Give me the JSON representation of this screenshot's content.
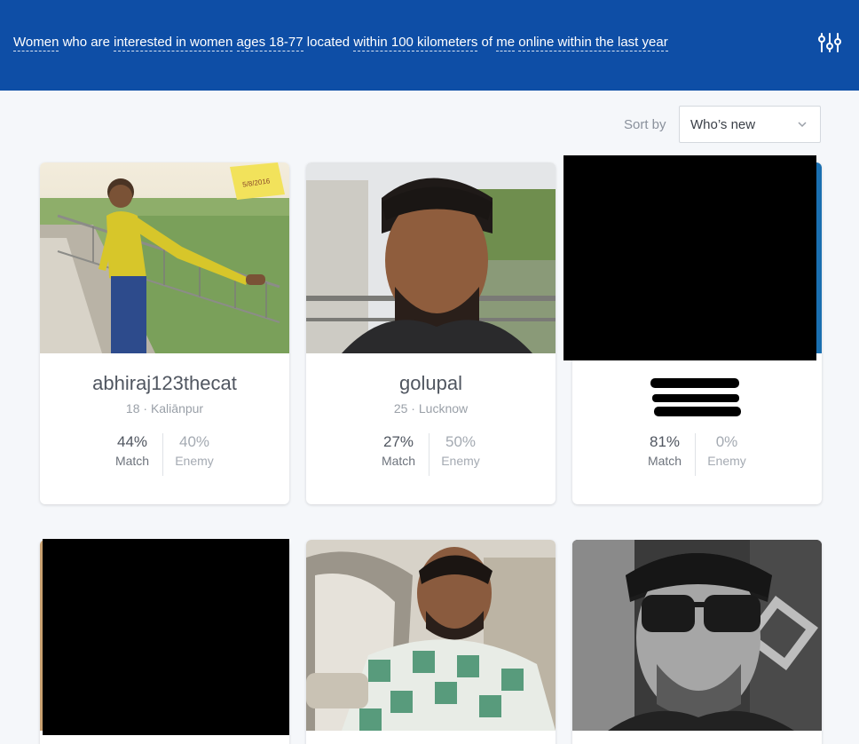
{
  "filter": {
    "who": "Women",
    "text1": " who are ",
    "interest": "interested in women",
    "text2": " ",
    "ages": "ages 18-77",
    "text3": " located ",
    "distance": "within 100 kilometers",
    "text4": " of ",
    "location": "me",
    "text5": " ",
    "online": "online within the last year"
  },
  "sort": {
    "label": "Sort by",
    "value": "Who’s new"
  },
  "icons": {
    "filters": "sliders-icon",
    "sort_chevron": "chevron-down-icon"
  },
  "colors": {
    "header": "#0e4ea6",
    "page_bg": "#f5f7fa"
  },
  "cards": [
    {
      "username": "abhiraj123thecat",
      "age": "18",
      "sep": " · ",
      "location": "Kaliānpur",
      "match": "44%",
      "match_label": "Match",
      "enemy": "40%",
      "enemy_label": "Enemy",
      "photo_sticker": "5/8/2016"
    },
    {
      "username": "golupal",
      "age": "25",
      "sep": " · ",
      "location": "Lucknow",
      "match": "27%",
      "match_label": "Match",
      "enemy": "50%",
      "enemy_label": "Enemy"
    },
    {
      "match": "81%",
      "match_label": "Match",
      "enemy": "0%",
      "enemy_label": "Enemy"
    }
  ]
}
